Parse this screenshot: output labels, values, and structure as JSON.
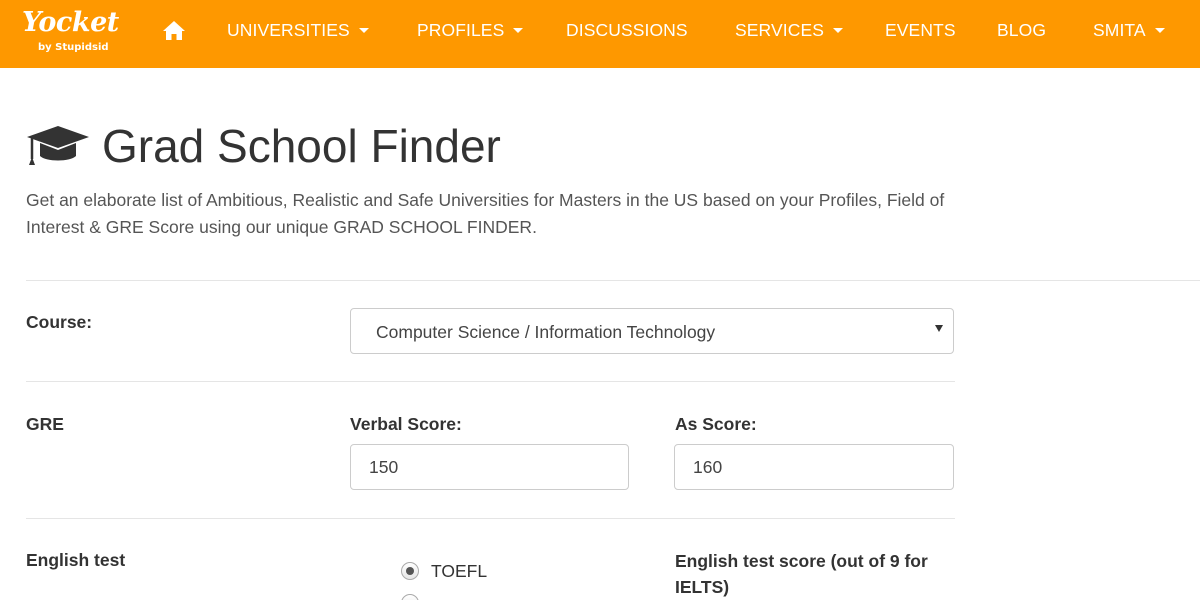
{
  "nav": {
    "logo_text": "Yocket",
    "logo_sub": "by Stupidsid",
    "home_icon": "home-icon",
    "items": [
      {
        "label": "UNIVERSITIES",
        "dropdown": true
      },
      {
        "label": "PROFILES",
        "dropdown": true
      },
      {
        "label": "DISCUSSIONS",
        "dropdown": false
      },
      {
        "label": "SERVICES",
        "dropdown": true
      },
      {
        "label": "EVENTS",
        "dropdown": false
      },
      {
        "label": "BLOG",
        "dropdown": false
      },
      {
        "label": "SMITA",
        "dropdown": true
      }
    ],
    "bg_color": "#fe9800"
  },
  "header": {
    "icon": "graduation-cap-icon",
    "title": "Grad School Finder",
    "description": "Get an elaborate list of Ambitious, Realistic and Safe Universities for Masters in the US based on your Profiles, Field of Interest & GRE Score using our unique GRAD SCHOOL FINDER."
  },
  "form": {
    "course": {
      "label": "Course:",
      "selected": "Computer Science / Information Technology"
    },
    "gre": {
      "label": "GRE",
      "verbal_label": "Verbal Score:",
      "verbal_value": "150",
      "as_label": "As Score:",
      "as_value": "160"
    },
    "english": {
      "label": "English test",
      "options": [
        {
          "label": "TOEFL",
          "checked": true
        }
      ],
      "score_label": "English test score (out of 9 for IELTS)"
    }
  }
}
